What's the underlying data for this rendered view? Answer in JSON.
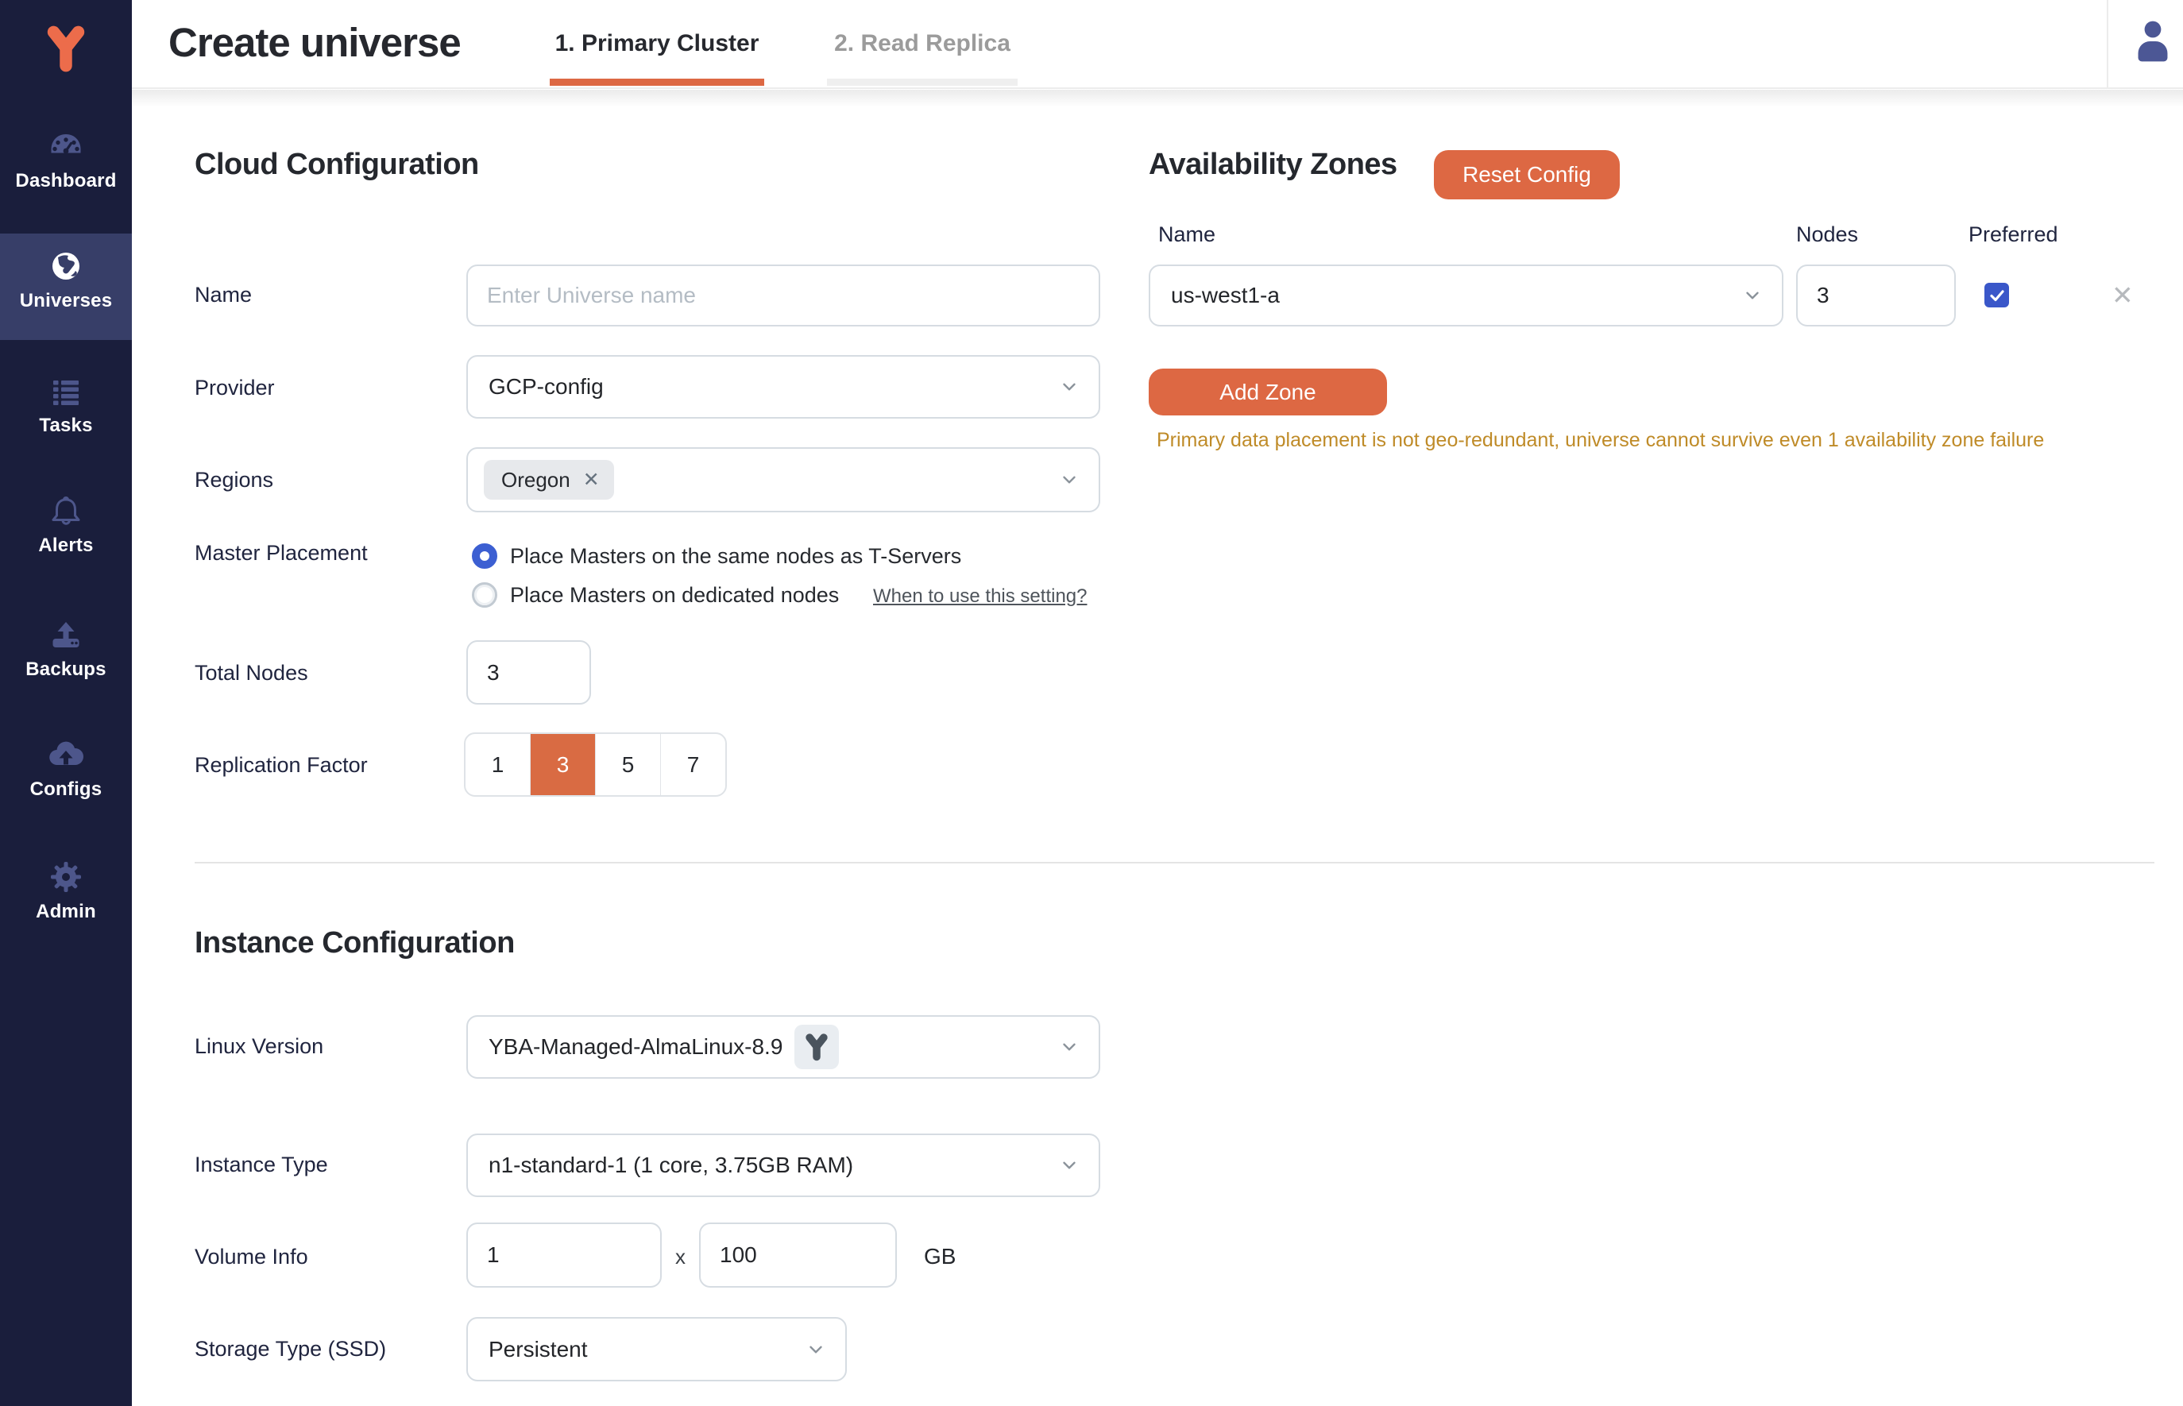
{
  "app": {
    "accent_orange": "#dd6843",
    "accent_blue": "#3c5fd2",
    "sidebar_bg": "#1a1e3c",
    "warning_color": "#bf8b28"
  },
  "header": {
    "title": "Create universe",
    "tabs": [
      {
        "label": "1. Primary Cluster",
        "active": true
      },
      {
        "label": "2. Read Replica",
        "active": false
      }
    ]
  },
  "sidebar": {
    "items": [
      {
        "label": "Dashboard",
        "icon": "gauge-icon",
        "active": false
      },
      {
        "label": "Universes",
        "icon": "globe-icon",
        "active": true
      },
      {
        "label": "Tasks",
        "icon": "tasks-icon",
        "active": false
      },
      {
        "label": "Alerts",
        "icon": "bell-icon",
        "active": false
      },
      {
        "label": "Backups",
        "icon": "backup-upload-icon",
        "active": false
      },
      {
        "label": "Configs",
        "icon": "cloud-upload-icon",
        "active": false
      },
      {
        "label": "Admin",
        "icon": "gear-icon",
        "active": false
      }
    ]
  },
  "cloud_config": {
    "heading": "Cloud Configuration",
    "name": {
      "label": "Name",
      "placeholder": "Enter Universe name",
      "value": ""
    },
    "provider": {
      "label": "Provider",
      "value": "GCP-config"
    },
    "regions": {
      "label": "Regions",
      "chips": [
        {
          "label": "Oregon",
          "remove": "✕"
        }
      ]
    },
    "master_placement": {
      "label": "Master Placement",
      "options": [
        {
          "label": "Place Masters on the same nodes as T-Servers",
          "selected": true
        },
        {
          "label": "Place Masters on dedicated nodes",
          "selected": false
        }
      ],
      "help_link": "When to use this setting?"
    },
    "total_nodes": {
      "label": "Total Nodes",
      "value": "3"
    },
    "replication_factor": {
      "label": "Replication Factor",
      "options": [
        "1",
        "3",
        "5",
        "7"
      ],
      "selected": "3"
    }
  },
  "availability_zones": {
    "heading": "Availability Zones",
    "reset_button": "Reset Config",
    "columns": {
      "name": "Name",
      "nodes": "Nodes",
      "preferred": "Preferred"
    },
    "zones": [
      {
        "name": "us-west1-a",
        "nodes": "3",
        "preferred": true,
        "remove": "✕"
      }
    ],
    "add_zone_button": "Add Zone",
    "warning": "Primary data placement is not geo-redundant, universe cannot survive even 1 availability zone failure"
  },
  "instance_config": {
    "heading": "Instance Configuration",
    "linux_version": {
      "label": "Linux Version",
      "value": "YBA-Managed-AlmaLinux-8.9"
    },
    "instance_type": {
      "label": "Instance Type",
      "value": "n1-standard-1 (1 core, 3.75GB RAM)"
    },
    "volume_info": {
      "label": "Volume Info",
      "count": "1",
      "multiplier": "x",
      "size": "100",
      "unit": "GB"
    },
    "storage_type": {
      "label": "Storage Type (SSD)",
      "value": "Persistent"
    }
  }
}
